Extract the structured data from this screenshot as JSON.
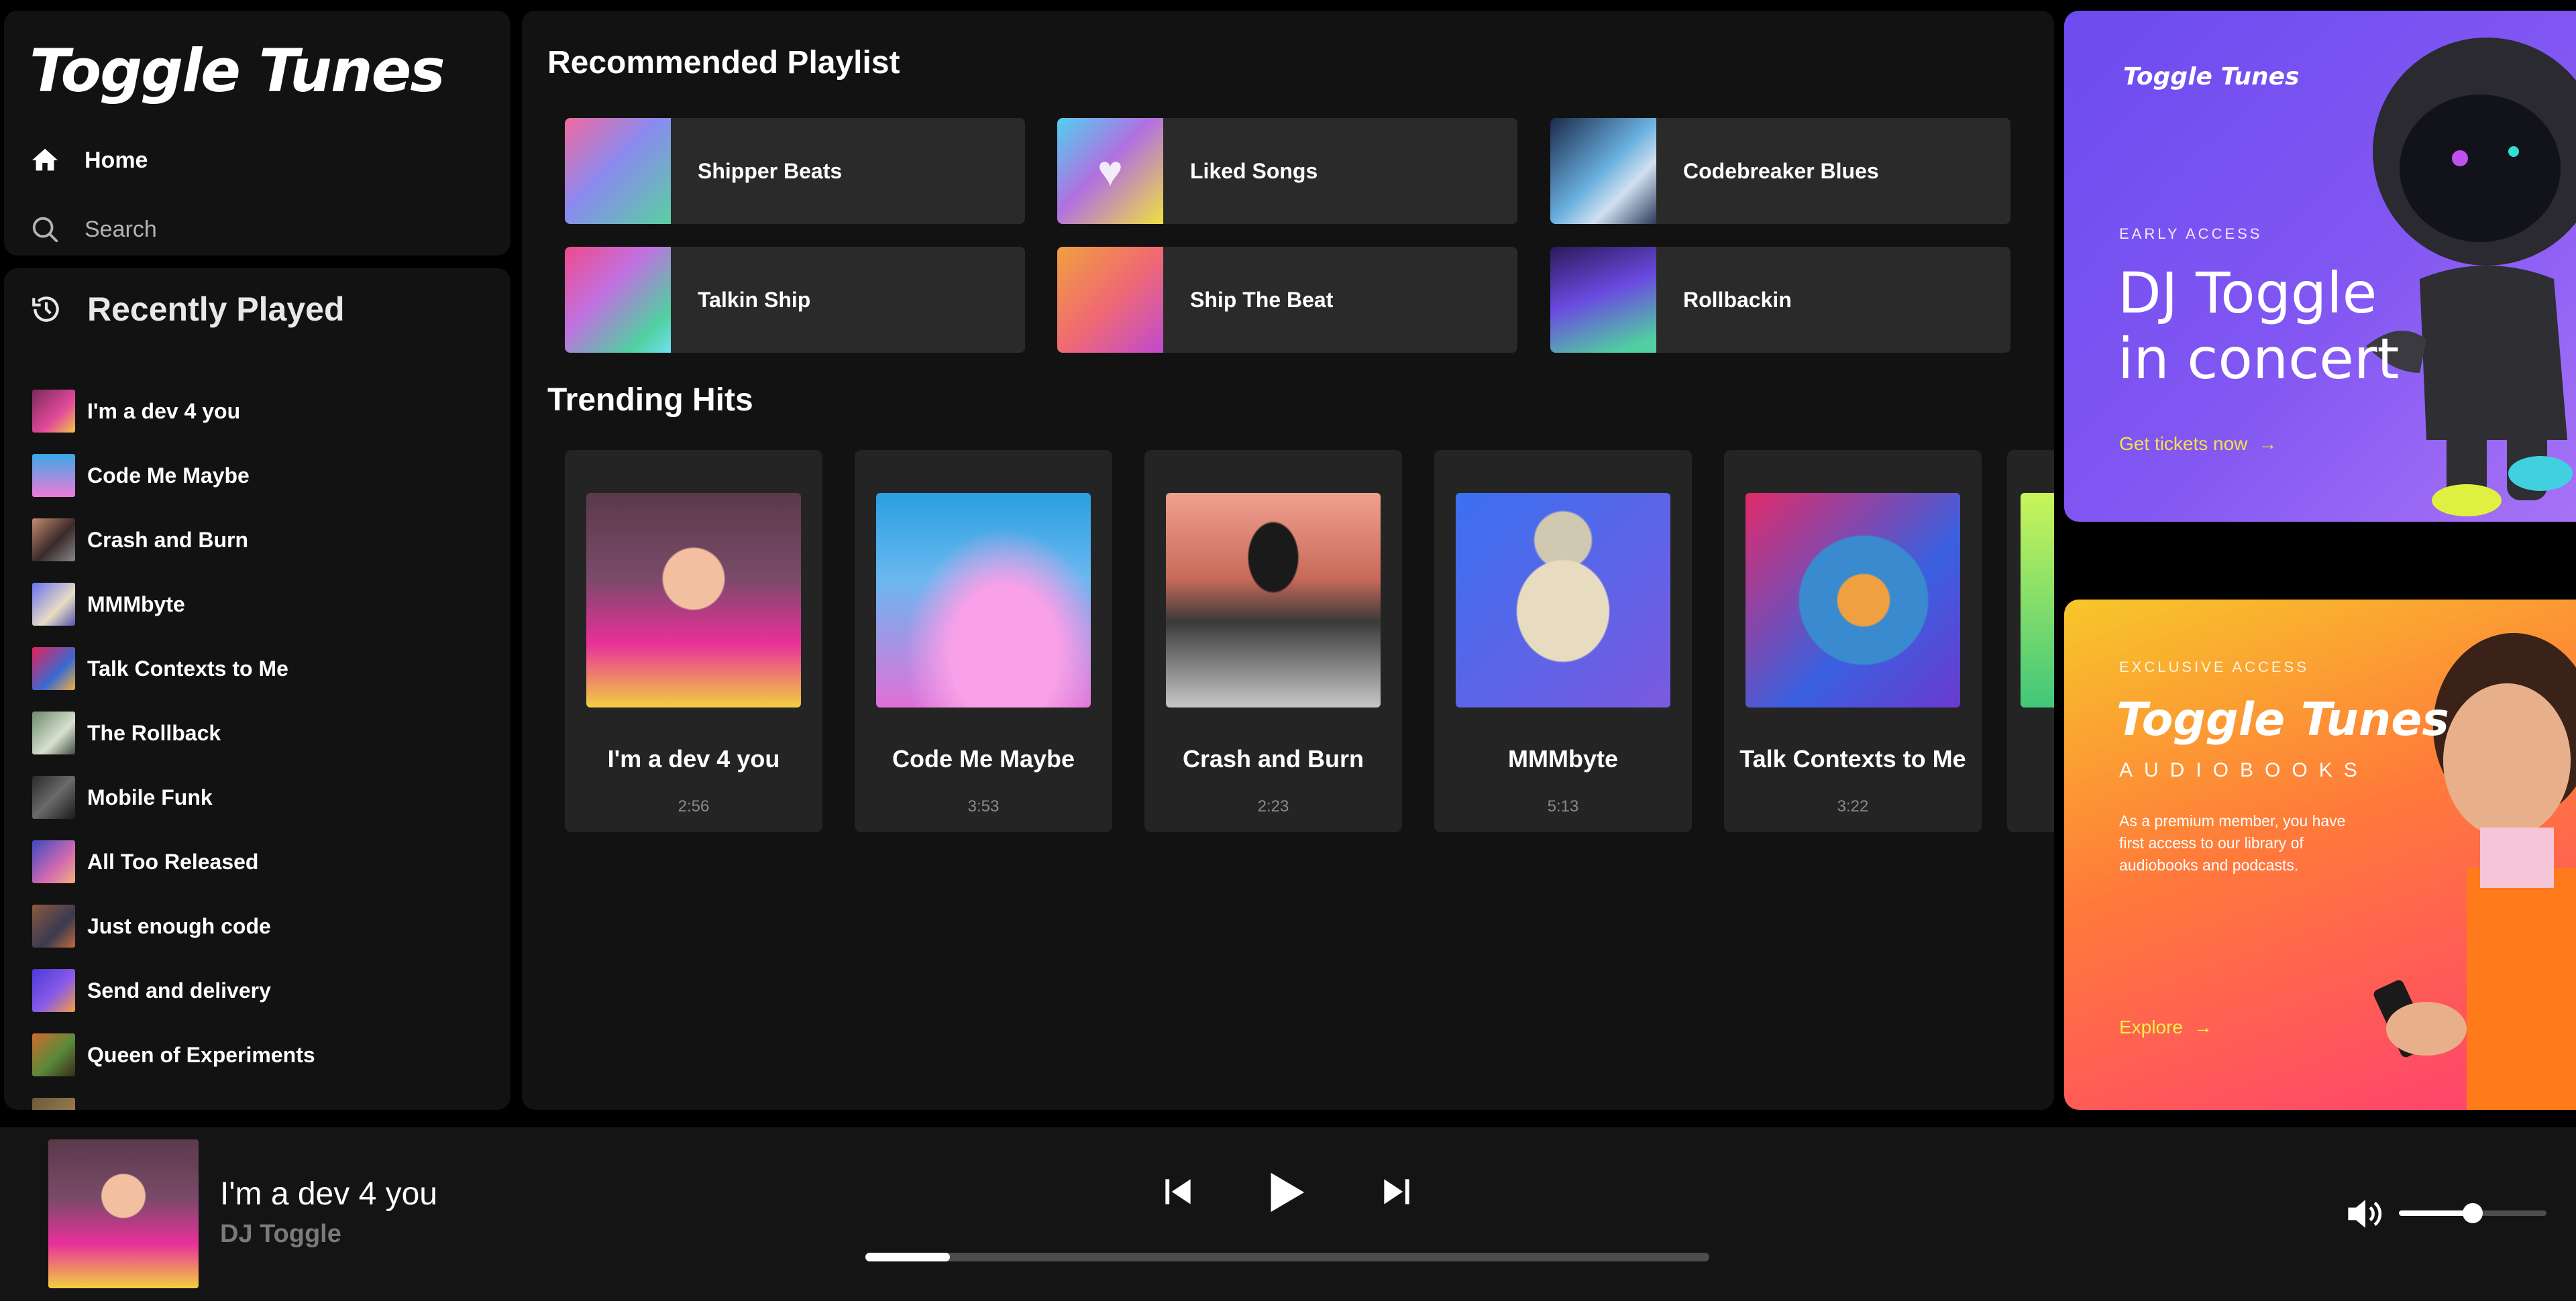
{
  "app": {
    "logo_text": "Toggle Tunes"
  },
  "nav": {
    "home_label": "Home",
    "search_label": "Search"
  },
  "recent": {
    "title": "Recently Played",
    "items": [
      {
        "title": "I'm a dev 4 you"
      },
      {
        "title": "Code Me Maybe"
      },
      {
        "title": "Crash and Burn"
      },
      {
        "title": "MMMbyte"
      },
      {
        "title": "Talk Contexts to Me"
      },
      {
        "title": "The Rollback"
      },
      {
        "title": "Mobile Funk"
      },
      {
        "title": "All Too Released"
      },
      {
        "title": "Just enough code"
      },
      {
        "title": "Send and delivery"
      },
      {
        "title": "Queen of Experiments"
      }
    ]
  },
  "recommended": {
    "title": "Recommended Playlist",
    "playlists": [
      {
        "name": "Shipper Beats"
      },
      {
        "name": "Liked Songs"
      },
      {
        "name": "Codebreaker Blues"
      },
      {
        "name": "Talkin Ship"
      },
      {
        "name": "Ship The Beat"
      },
      {
        "name": "Rollbackin"
      }
    ]
  },
  "trending": {
    "title": "Trending Hits",
    "tracks": [
      {
        "title": "I'm a dev 4 you",
        "duration": "2:56"
      },
      {
        "title": "Code Me Maybe",
        "duration": "3:53"
      },
      {
        "title": "Crash and Burn",
        "duration": "2:23"
      },
      {
        "title": "MMMbyte",
        "duration": "5:13"
      },
      {
        "title": "Talk Contexts to Me",
        "duration": "3:22"
      }
    ]
  },
  "concert_banner": {
    "logo": "Toggle Tunes",
    "eyebrow": "EARLY ACCESS",
    "headline_1": "DJ Toggle",
    "headline_2": "in concert",
    "cta": "Get tickets now"
  },
  "audiobook_banner": {
    "eyebrow": "EXCLUSIVE ACCESS",
    "logo": "Toggle Tunes",
    "subtitle": "AUDIOBOOKS",
    "body_1": "As a premium member, you have",
    "body_2": "first access to our library of",
    "body_3": "audiobooks and podcasts.",
    "cta": "Explore"
  },
  "player": {
    "title": "I'm a dev 4 you",
    "artist": "DJ Toggle",
    "progress": 0.1,
    "volume": 0.5
  },
  "colors": {
    "accent": "#1ed760",
    "panel": "#121212",
    "card": "#2a2a2b"
  },
  "icons": [
    "home-icon",
    "search-icon",
    "history-icon",
    "previous-icon",
    "play-icon",
    "next-icon",
    "volume-icon",
    "arrow-right-icon"
  ]
}
